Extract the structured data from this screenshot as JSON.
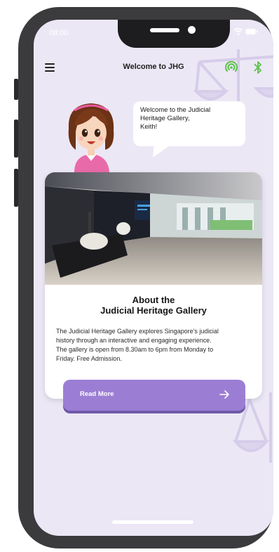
{
  "status_bar": {
    "time": "08:00",
    "signal_icon": "wifi-icon",
    "battery_icon": "battery-icon"
  },
  "header": {
    "title": "Welcome to JHG",
    "menu_icon": "hamburger-menu-icon",
    "nfc_icon": "nfc-icon",
    "bluetooth_icon": "bluetooth-icon"
  },
  "greeting": {
    "line1": "Welcome to the Judicial",
    "line2": "Heritage Gallery,",
    "line3": "Keith!"
  },
  "card": {
    "heading_line1": "About the",
    "heading_line2": "Judicial Heritage Gallery",
    "body_line1": "The Judicial Heritage Gallery explores Singapore's judicial",
    "body_line2": "history through an interactive and engaging experience.",
    "body_line3": "The gallery is open from 8.30am to 6pm from Monday to",
    "body_line4": "Friday. Free Admission.",
    "read_more_label": "Read More",
    "arrow_icon": "arrow-right-icon"
  },
  "colors": {
    "screen_bg": "#ece7f5",
    "accent": "#9b7ed4",
    "nfc": "#5cc24a",
    "bluetooth": "#5cc24a"
  }
}
